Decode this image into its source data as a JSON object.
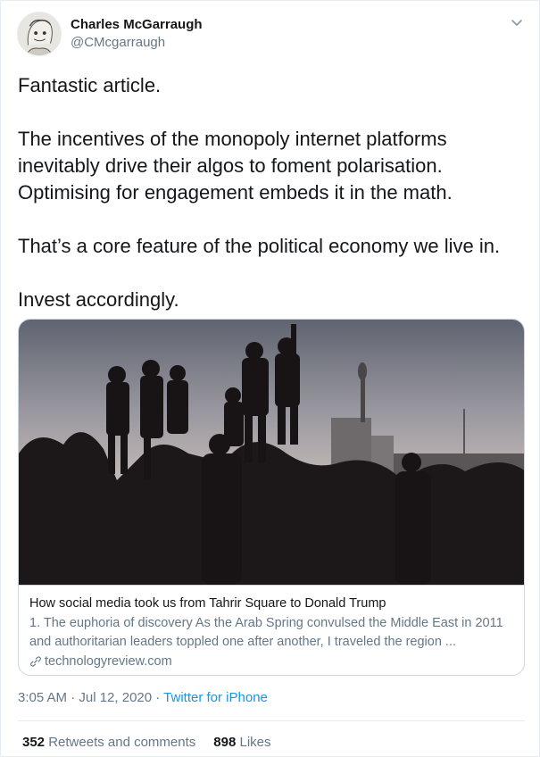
{
  "author": {
    "name": "Charles McGarraugh",
    "handle": "@CMcgarraugh"
  },
  "tweet": {
    "lines": [
      "Fantastic article.",
      "",
      "The incentives of the monopoly internet platforms",
      "inevitably drive their algos to foment polarisation.",
      "Optimising for engagement embeds it in the math.",
      "",
      "That’s a core feature of the political economy we live in.",
      "",
      "Invest accordingly."
    ]
  },
  "link_card": {
    "title": "How social media took us from Tahrir Square to Donald Trump",
    "description": "1. The euphoria of discovery As the Arab Spring convulsed the Middle East in 2011 and authoritarian leaders toppled one after another, I traveled the region ...",
    "domain": "technologyreview.com"
  },
  "meta": {
    "time": "3:05 AM · Jul 12, 2020 · ",
    "source": "Twitter for iPhone"
  },
  "stats": {
    "retweets_count": "352",
    "retweets_label": "Retweets and comments",
    "likes_count": "898",
    "likes_label": "Likes"
  },
  "colors": {
    "link_blue": "#1b95e0",
    "secondary_text": "#657786",
    "primary_text": "#14171a",
    "border": "#ccd6dd"
  },
  "icons": {
    "menu": "chevron-down-icon",
    "link": "link-icon"
  }
}
